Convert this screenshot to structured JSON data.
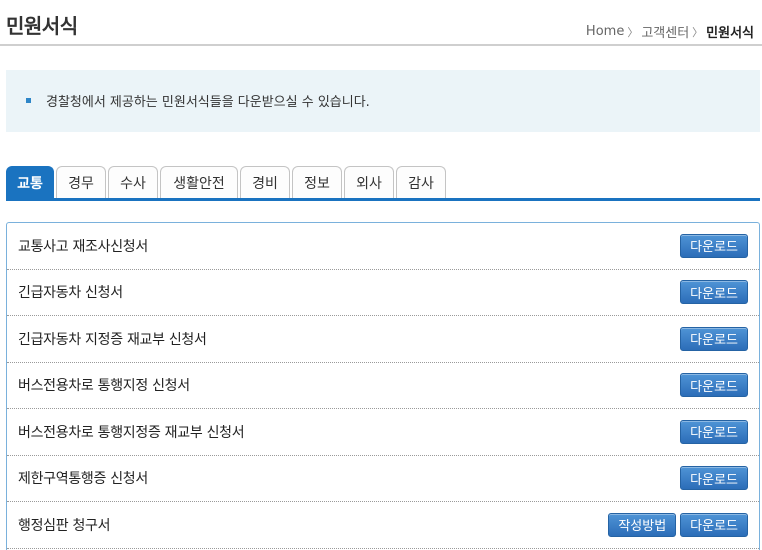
{
  "header": {
    "title": "민원서식",
    "breadcrumb": {
      "home": "Home",
      "section": "고객센터",
      "current": "민원서식",
      "separator": "〉"
    }
  },
  "notice": {
    "text": "경찰청에서 제공하는 민원서식들을 다운받으실 수 있습니다."
  },
  "tabs": [
    {
      "label": "교통",
      "active": true
    },
    {
      "label": "경무"
    },
    {
      "label": "수사"
    },
    {
      "label": "생활안전"
    },
    {
      "label": "경비"
    },
    {
      "label": "정보"
    },
    {
      "label": "외사"
    },
    {
      "label": "감사"
    }
  ],
  "forms": [
    {
      "name": "교통사고 재조사신청서",
      "download": "다운로드"
    },
    {
      "name": "긴급자동차 신청서",
      "download": "다운로드"
    },
    {
      "name": "긴급자동차 지정증 재교부 신청서",
      "download": "다운로드"
    },
    {
      "name": "버스전용차로 통행지정 신청서",
      "download": "다운로드"
    },
    {
      "name": "버스전용차로 통행지정증 재교부 신청서",
      "download": "다운로드"
    },
    {
      "name": "제한구역통행증 신청서",
      "download": "다운로드"
    },
    {
      "name": "행정심판 청구서",
      "guide": "작성방법",
      "download": "다운로드"
    }
  ],
  "colors": {
    "accent": "#1a73c0",
    "button": "#2c6db8",
    "notice_bg": "#ebf4f8"
  }
}
